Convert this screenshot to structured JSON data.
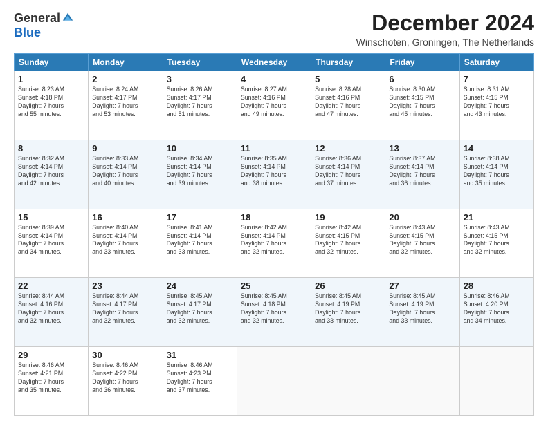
{
  "logo": {
    "general": "General",
    "blue": "Blue"
  },
  "title": "December 2024",
  "location": "Winschoten, Groningen, The Netherlands",
  "days_header": [
    "Sunday",
    "Monday",
    "Tuesday",
    "Wednesday",
    "Thursday",
    "Friday",
    "Saturday"
  ],
  "weeks": [
    [
      {
        "day": "1",
        "info": "Sunrise: 8:23 AM\nSunset: 4:18 PM\nDaylight: 7 hours\nand 55 minutes."
      },
      {
        "day": "2",
        "info": "Sunrise: 8:24 AM\nSunset: 4:17 PM\nDaylight: 7 hours\nand 53 minutes."
      },
      {
        "day": "3",
        "info": "Sunrise: 8:26 AM\nSunset: 4:17 PM\nDaylight: 7 hours\nand 51 minutes."
      },
      {
        "day": "4",
        "info": "Sunrise: 8:27 AM\nSunset: 4:16 PM\nDaylight: 7 hours\nand 49 minutes."
      },
      {
        "day": "5",
        "info": "Sunrise: 8:28 AM\nSunset: 4:16 PM\nDaylight: 7 hours\nand 47 minutes."
      },
      {
        "day": "6",
        "info": "Sunrise: 8:30 AM\nSunset: 4:15 PM\nDaylight: 7 hours\nand 45 minutes."
      },
      {
        "day": "7",
        "info": "Sunrise: 8:31 AM\nSunset: 4:15 PM\nDaylight: 7 hours\nand 43 minutes."
      }
    ],
    [
      {
        "day": "8",
        "info": "Sunrise: 8:32 AM\nSunset: 4:14 PM\nDaylight: 7 hours\nand 42 minutes."
      },
      {
        "day": "9",
        "info": "Sunrise: 8:33 AM\nSunset: 4:14 PM\nDaylight: 7 hours\nand 40 minutes."
      },
      {
        "day": "10",
        "info": "Sunrise: 8:34 AM\nSunset: 4:14 PM\nDaylight: 7 hours\nand 39 minutes."
      },
      {
        "day": "11",
        "info": "Sunrise: 8:35 AM\nSunset: 4:14 PM\nDaylight: 7 hours\nand 38 minutes."
      },
      {
        "day": "12",
        "info": "Sunrise: 8:36 AM\nSunset: 4:14 PM\nDaylight: 7 hours\nand 37 minutes."
      },
      {
        "day": "13",
        "info": "Sunrise: 8:37 AM\nSunset: 4:14 PM\nDaylight: 7 hours\nand 36 minutes."
      },
      {
        "day": "14",
        "info": "Sunrise: 8:38 AM\nSunset: 4:14 PM\nDaylight: 7 hours\nand 35 minutes."
      }
    ],
    [
      {
        "day": "15",
        "info": "Sunrise: 8:39 AM\nSunset: 4:14 PM\nDaylight: 7 hours\nand 34 minutes."
      },
      {
        "day": "16",
        "info": "Sunrise: 8:40 AM\nSunset: 4:14 PM\nDaylight: 7 hours\nand 33 minutes."
      },
      {
        "day": "17",
        "info": "Sunrise: 8:41 AM\nSunset: 4:14 PM\nDaylight: 7 hours\nand 33 minutes."
      },
      {
        "day": "18",
        "info": "Sunrise: 8:42 AM\nSunset: 4:14 PM\nDaylight: 7 hours\nand 32 minutes."
      },
      {
        "day": "19",
        "info": "Sunrise: 8:42 AM\nSunset: 4:15 PM\nDaylight: 7 hours\nand 32 minutes."
      },
      {
        "day": "20",
        "info": "Sunrise: 8:43 AM\nSunset: 4:15 PM\nDaylight: 7 hours\nand 32 minutes."
      },
      {
        "day": "21",
        "info": "Sunrise: 8:43 AM\nSunset: 4:15 PM\nDaylight: 7 hours\nand 32 minutes."
      }
    ],
    [
      {
        "day": "22",
        "info": "Sunrise: 8:44 AM\nSunset: 4:16 PM\nDaylight: 7 hours\nand 32 minutes."
      },
      {
        "day": "23",
        "info": "Sunrise: 8:44 AM\nSunset: 4:17 PM\nDaylight: 7 hours\nand 32 minutes."
      },
      {
        "day": "24",
        "info": "Sunrise: 8:45 AM\nSunset: 4:17 PM\nDaylight: 7 hours\nand 32 minutes."
      },
      {
        "day": "25",
        "info": "Sunrise: 8:45 AM\nSunset: 4:18 PM\nDaylight: 7 hours\nand 32 minutes."
      },
      {
        "day": "26",
        "info": "Sunrise: 8:45 AM\nSunset: 4:19 PM\nDaylight: 7 hours\nand 33 minutes."
      },
      {
        "day": "27",
        "info": "Sunrise: 8:45 AM\nSunset: 4:19 PM\nDaylight: 7 hours\nand 33 minutes."
      },
      {
        "day": "28",
        "info": "Sunrise: 8:46 AM\nSunset: 4:20 PM\nDaylight: 7 hours\nand 34 minutes."
      }
    ],
    [
      {
        "day": "29",
        "info": "Sunrise: 8:46 AM\nSunset: 4:21 PM\nDaylight: 7 hours\nand 35 minutes."
      },
      {
        "day": "30",
        "info": "Sunrise: 8:46 AM\nSunset: 4:22 PM\nDaylight: 7 hours\nand 36 minutes."
      },
      {
        "day": "31",
        "info": "Sunrise: 8:46 AM\nSunset: 4:23 PM\nDaylight: 7 hours\nand 37 minutes."
      },
      {
        "day": "",
        "info": ""
      },
      {
        "day": "",
        "info": ""
      },
      {
        "day": "",
        "info": ""
      },
      {
        "day": "",
        "info": ""
      }
    ]
  ]
}
